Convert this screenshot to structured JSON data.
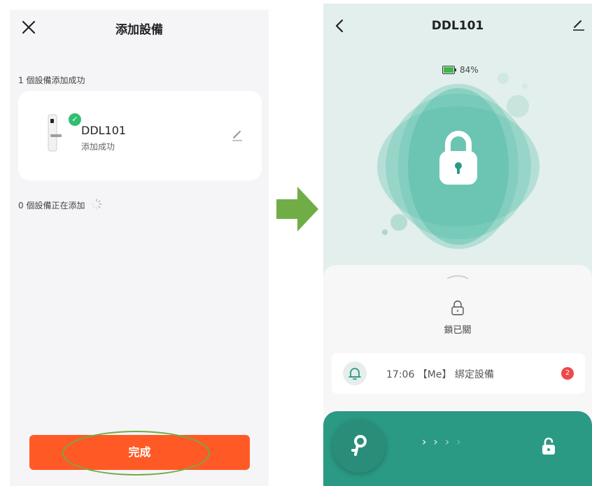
{
  "left": {
    "title": "添加設備",
    "success_count_text": "1 個設備添加成功",
    "device": {
      "name": "DDL101",
      "status": "添加成功"
    },
    "adding_count_text": "0 個設備正在添加",
    "done_label": "完成"
  },
  "right": {
    "title": "DDL101",
    "battery_level": "84%",
    "lock_status": "鎖已關",
    "log": {
      "text": "17:06 【Me】 綁定設備",
      "badge_count": "2"
    }
  },
  "colors": {
    "done_button": "#ff5a26",
    "teal": "#2b9a84",
    "success_green": "#2fbf6f",
    "arrow_green": "#70ad47",
    "badge_red": "#f04848"
  },
  "icons": [
    "close-icon",
    "edit-icon",
    "check-icon",
    "spinner-icon",
    "back-icon",
    "pen-icon",
    "battery-icon",
    "padlock-icon",
    "chevron-up-icon",
    "lock-icon",
    "bell-icon",
    "key-icon",
    "unlock-icon",
    "arrow-right-icon"
  ]
}
